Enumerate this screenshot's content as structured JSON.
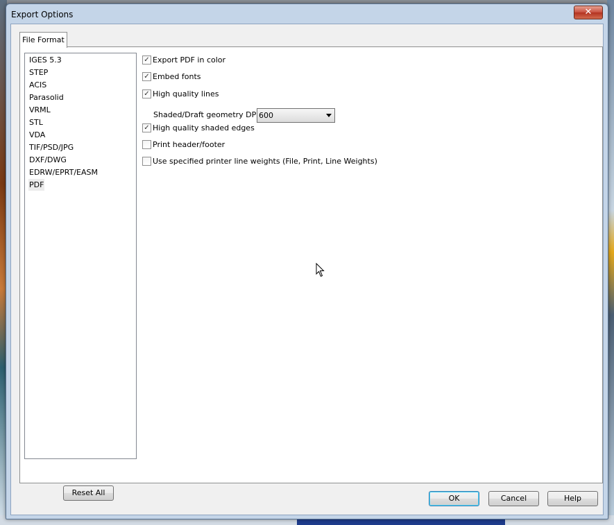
{
  "dialog": {
    "title": "Export Options",
    "close_glyph": "✕"
  },
  "tabs": [
    {
      "label": "File Format"
    }
  ],
  "formats": [
    "IGES 5.3",
    "STEP",
    "ACIS",
    "Parasolid",
    "VRML",
    "STL",
    "VDA",
    "TIF/PSD/JPG",
    "DXF/DWG",
    "EDRW/EPRT/EASM",
    "PDF"
  ],
  "selected_format": "PDF",
  "options": {
    "export_color": {
      "label": "Export PDF in color",
      "checked": true
    },
    "embed_fonts": {
      "label": "Embed fonts",
      "checked": true
    },
    "hq_lines": {
      "label": "High quality lines",
      "checked": true
    },
    "dpi": {
      "label": "Shaded/Draft geometry DPI:",
      "value": "600"
    },
    "hq_edges": {
      "label": "High quality shaded edges",
      "checked": true
    },
    "header_footer": {
      "label": "Print header/footer",
      "checked": false
    },
    "printer_weights": {
      "label": "Use specified printer line weights (File, Print, Line Weights)",
      "checked": false
    }
  },
  "buttons": {
    "reset": "Reset All",
    "ok": "OK",
    "cancel": "Cancel",
    "help": "Help"
  },
  "check_glyph": "✓"
}
